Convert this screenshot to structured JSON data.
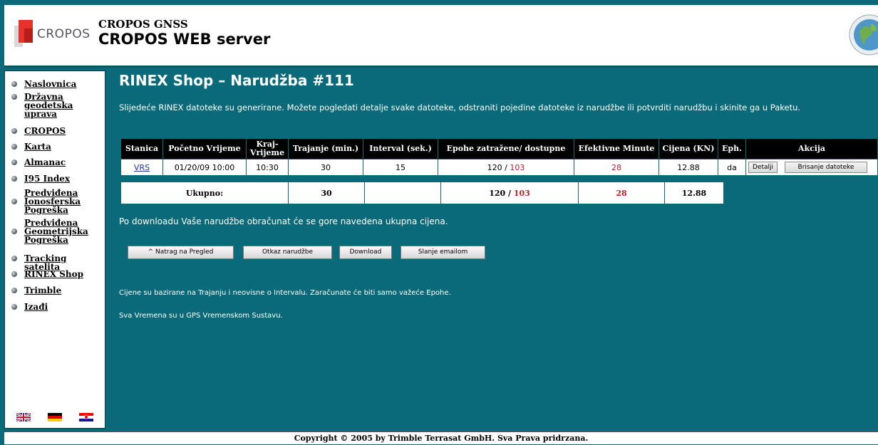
{
  "header": {
    "logo_text": "CROPOS",
    "line1": "CROPOS GNSS",
    "line2": "CROPOS WEB server"
  },
  "sidebar": {
    "items": [
      {
        "label": "Naslovnica"
      },
      {
        "label": "Državna geodetska uprava"
      },
      {
        "label": "CROPOS"
      },
      {
        "label": "Karta"
      },
      {
        "label": "Almanac"
      },
      {
        "label": "I95 Index"
      },
      {
        "label": "Predviđena Ionosferska Pogreška"
      },
      {
        "label": "Predviđena Geometrijska Pogreška"
      },
      {
        "label": "Tracking satelita"
      },
      {
        "label": "RINEX Shop"
      },
      {
        "label": "Trimble"
      },
      {
        "label": "Izađi"
      }
    ]
  },
  "main": {
    "title": "RINEX Shop – Narudžba #111",
    "intro": "Slijedeće RINEX datoteke su generirane. Možete pogledati detalje svake datoteke, odstraniti pojedine datoteke iz narudžbe ili potvrditi narudžbu i skinite ga u Paketu.",
    "table": {
      "headers": {
        "stanica": "Stanica",
        "pocetno": "Početno Vrijeme",
        "kraj": "Kraj-Vrijeme",
        "trajanje": "Trajanje (min.)",
        "interval": "Interval (sek.)",
        "epohe": "Epohe zatražene/ dostupne",
        "efektivne": "Efektivne Minute",
        "cijena": "Cijena (KN)",
        "eph": "Eph.",
        "akcija": "Akcija"
      },
      "row": {
        "stanica": "VRS",
        "pocetno": "01/20/09 10:00",
        "kraj": "10:30",
        "trajanje": "30",
        "interval": "15",
        "epohe_req": "120",
        "epohe_sep": " / ",
        "epohe_avail": "103",
        "efektivne": "28",
        "cijena": "12.88",
        "eph": "da",
        "btn_details": "Detalji",
        "btn_delete": "Brisanje datoteke"
      }
    },
    "total": {
      "label": "Ukupno:",
      "trajanje": "30",
      "epohe_req": "120",
      "epohe_sep": " / ",
      "epohe_avail": "103",
      "efektivne": "28",
      "cijena": "12.88"
    },
    "note1": "Po downloadu Vaše narudžbe obračunat će se gore navedena ukupna cijena.",
    "buttons": {
      "back": "^ Natrag na Pregled",
      "cancel": "Otkaz narudžbe",
      "download": "Download",
      "email": "Slanje emailom"
    },
    "note2": "Cijene su bazirane na Trajanju i neovisne o Intervalu. Zaračunate će biti samo važeće Epohe.",
    "note3": "Sva Vremena su u GPS Vremenskom Sustavu."
  },
  "footer": "Copyright © 2005 by Trimble Terrasat GmbH. Sva Prava pridrzana.",
  "colors": {
    "background": "#0b6a79",
    "red_value": "#c0202b",
    "link": "#2233aa"
  },
  "flags": [
    "uk-flag-icon",
    "germany-flag-icon",
    "croatia-flag-icon"
  ]
}
